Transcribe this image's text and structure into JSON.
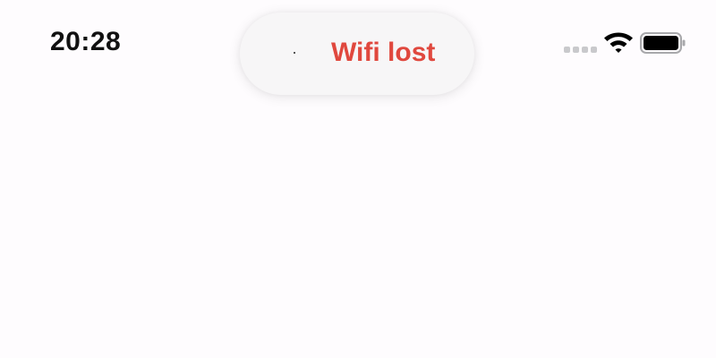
{
  "status_bar": {
    "time": "20:28",
    "signal_icon": "cellular-signal-icon",
    "wifi_icon": "wifi-icon",
    "battery_icon": "battery-icon"
  },
  "toast": {
    "icon": "wifi-status-icon",
    "message": "Wifi lost",
    "message_color": "#e0483e"
  },
  "colors": {
    "background": "#fefcfe",
    "toast_background": "#f7f6f7",
    "clock": "#111111"
  }
}
